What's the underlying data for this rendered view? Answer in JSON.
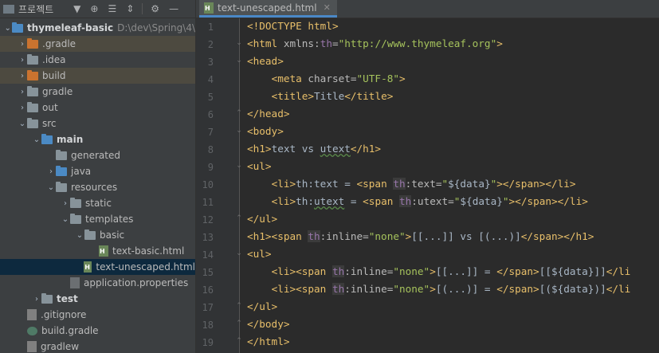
{
  "project_panel": {
    "title": "프로젝트",
    "tree": [
      {
        "label": "thymeleaf-basic",
        "extra": "D:\\dev\\Spring\\4\\",
        "depth": 0,
        "expanded": true,
        "icon": "folder-blue",
        "bold": true
      },
      {
        "label": ".gradle",
        "depth": 1,
        "expanded": false,
        "icon": "folder-orange",
        "highlight": true
      },
      {
        "label": ".idea",
        "depth": 1,
        "expanded": false,
        "icon": "folder-gray"
      },
      {
        "label": "build",
        "depth": 1,
        "expanded": false,
        "icon": "folder-orange",
        "highlight": true
      },
      {
        "label": "gradle",
        "depth": 1,
        "expanded": false,
        "icon": "folder-gray"
      },
      {
        "label": "out",
        "depth": 1,
        "expanded": false,
        "icon": "folder-gray"
      },
      {
        "label": "src",
        "depth": 1,
        "expanded": true,
        "icon": "folder-gray"
      },
      {
        "label": "main",
        "depth": 2,
        "expanded": true,
        "icon": "folder-blue",
        "bold": true
      },
      {
        "label": "generated",
        "depth": 3,
        "icon": "folder-gray"
      },
      {
        "label": "java",
        "depth": 3,
        "expanded": false,
        "icon": "folder-blue"
      },
      {
        "label": "resources",
        "depth": 3,
        "expanded": true,
        "icon": "folder-gray"
      },
      {
        "label": "static",
        "depth": 4,
        "expanded": false,
        "icon": "folder-gray"
      },
      {
        "label": "templates",
        "depth": 4,
        "expanded": true,
        "icon": "folder-gray"
      },
      {
        "label": "basic",
        "depth": 5,
        "expanded": true,
        "icon": "folder-gray"
      },
      {
        "label": "text-basic.html",
        "depth": 6,
        "icon": "file-html"
      },
      {
        "label": "text-unescaped.html",
        "depth": 6,
        "icon": "file-html",
        "selected": true
      },
      {
        "label": "application.properties",
        "depth": 4,
        "icon": "file-props"
      },
      {
        "label": "test",
        "depth": 2,
        "expanded": false,
        "icon": "folder-gray",
        "bold": true
      },
      {
        "label": ".gitignore",
        "depth": 1,
        "icon": "file-plain"
      },
      {
        "label": "build.gradle",
        "depth": 1,
        "icon": "file-gradle"
      },
      {
        "label": "gradlew",
        "depth": 1,
        "icon": "file-plain"
      }
    ]
  },
  "editor": {
    "tab_label": "text-unescaped.html",
    "line_numbers": [
      "1",
      "2",
      "3",
      "4",
      "5",
      "6",
      "7",
      "8",
      "9",
      "10",
      "11",
      "12",
      "13",
      "14",
      "15",
      "16",
      "17",
      "18",
      "19"
    ]
  }
}
